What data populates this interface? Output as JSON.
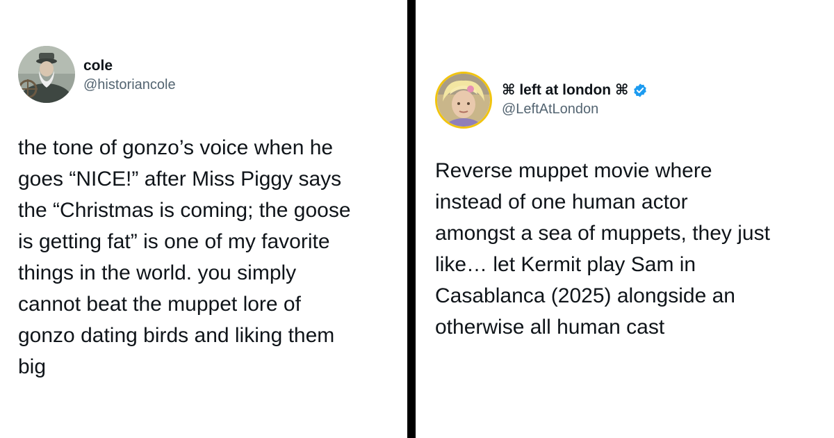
{
  "left_tweet": {
    "display_name": "cole",
    "handle": "@historiancole",
    "avatar_icon": "bearded-sailor-avatar",
    "text_lines": [
      "the tone of gonzo’s voice when he",
      "goes “NICE!” after Miss Piggy says",
      "the “Christmas is coming; the goose",
      "is getting fat” is one of my favorite",
      "things in the world. you simply",
      "cannot beat the muppet lore of",
      "gonzo dating birds and liking them",
      "big"
    ]
  },
  "right_tweet": {
    "display_name": "⌘ left at london ⌘",
    "handle": "@LeftAtLondon",
    "avatar_icon": "blonde-person-avatar",
    "verified_icon": "verified-badge-icon",
    "text_lines": [
      "Reverse muppet movie where",
      "instead of one human actor",
      "amongst a sea of muppets, they just",
      "like… let Kermit play Sam in",
      "Casablanca (2025) alongside an",
      "otherwise all human cast"
    ]
  },
  "colors": {
    "background": "#ffffff",
    "divider": "#000000",
    "text": "#0f1419",
    "handle": "#536471",
    "verified": "#1d9bf0"
  }
}
